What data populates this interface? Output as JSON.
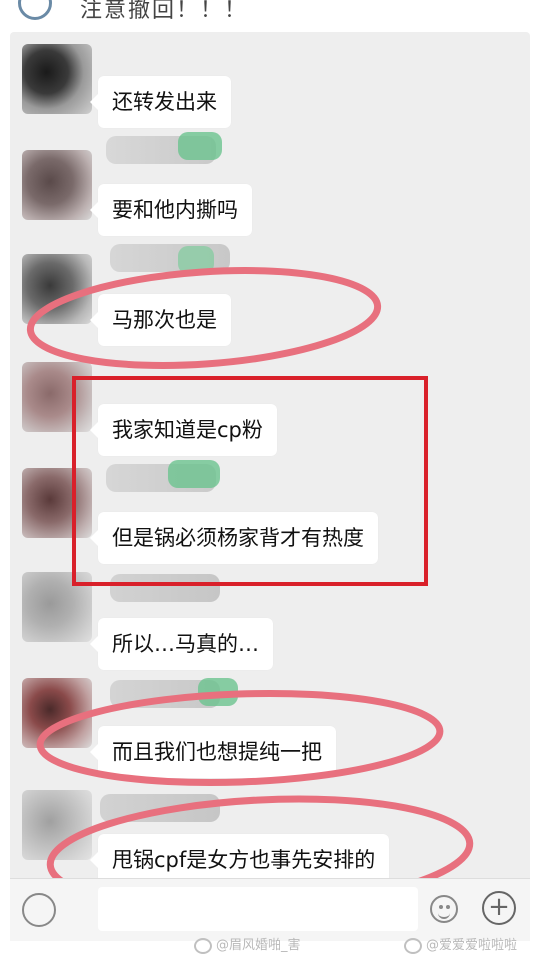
{
  "header": {
    "text": "注意撤回！！！"
  },
  "messages": [
    {
      "text": "还转发出来"
    },
    {
      "text": "要和他内撕吗"
    },
    {
      "text": "马那次也是"
    },
    {
      "text": "我家知道是cp粉"
    },
    {
      "text": "但是锅必须杨家背才有热度"
    },
    {
      "text": "所以…马真的…"
    },
    {
      "text": "而且我们也想提纯一把"
    },
    {
      "text": "甩锅cpf是女方也事先安排的"
    }
  ],
  "watermarks": {
    "left": "@眉风婚啪_害",
    "right": "@爱爱爱啦啦啦"
  },
  "colors": {
    "highlight_circle": "#e8707e",
    "highlight_box": "#d9202a",
    "bubble": "#ffffff",
    "chat_bg": "#eeeeee"
  },
  "icons": {
    "emoji": "emoji-icon",
    "plus": "plus-icon",
    "voice": "voice-icon"
  }
}
